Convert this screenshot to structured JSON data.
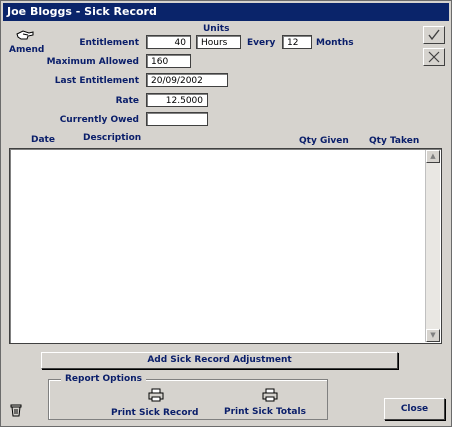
{
  "window": {
    "title": "Joe Bloggs - Sick Record"
  },
  "toolbar": {
    "amend_label": "Amend",
    "ok_icon": "check-icon",
    "cancel_icon": "cross-icon"
  },
  "form": {
    "units_header": "Units",
    "entitlement_label": "Entitlement",
    "entitlement_value": "40",
    "units_value": "Hours",
    "every_label": "Every",
    "every_value": "12",
    "months_label": "Months",
    "max_allowed_label": "Maximum Allowed",
    "max_allowed_value": "160",
    "last_entitlement_label": "Last Entitlement",
    "last_entitlement_value": "20/09/2002",
    "rate_label": "Rate",
    "rate_value": "12.5000",
    "currently_owed_label": "Currently Owed",
    "currently_owed_value": ""
  },
  "table": {
    "columns": [
      "Date",
      "Description",
      "Qty Given",
      "Qty Taken"
    ],
    "rows": []
  },
  "buttons": {
    "add_adjustment": "Add Sick Record Adjustment",
    "close": "Close"
  },
  "report_options": {
    "legend": "Report Options",
    "print_record": "Print Sick Record",
    "print_totals": "Print Sick Totals"
  },
  "colors": {
    "title_bar": "#0a246a",
    "label_text": "#0a1e6a",
    "background": "#d6d3ce"
  }
}
